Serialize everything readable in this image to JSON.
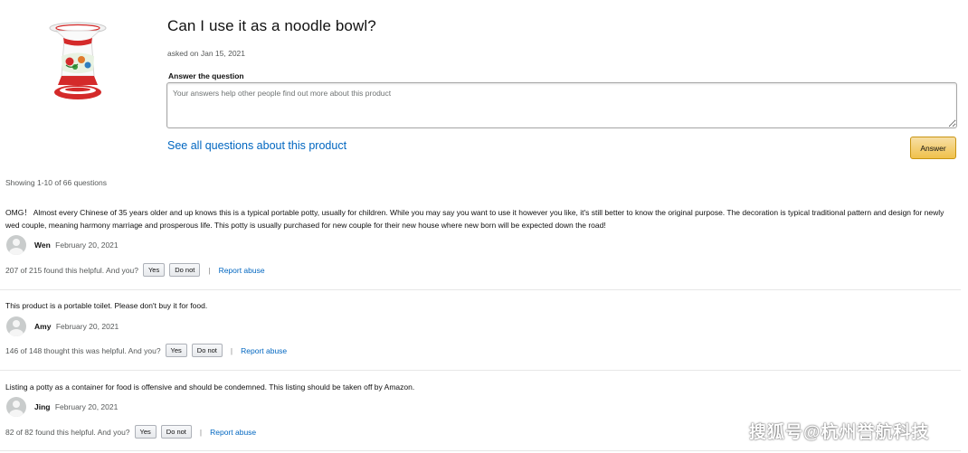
{
  "question": {
    "title": "Can I use it as a noodle bowl?",
    "asked_on": "asked on Jan 15, 2021",
    "answer_label": "Answer the question",
    "answer_placeholder": "Your answers help other people find out more about this product",
    "see_all": "See all questions about this product",
    "answer_button": "Answer"
  },
  "showing": "Showing 1-10 of 66 questions",
  "answers": [
    {
      "text": "OMG！ Almost every Chinese of 35 years older and up knows this is a typical portable potty, usually for children. While you may say you want to use it however you like, it's still better to know the original purpose. The decoration is typical traditional pattern and design for newly wed couple, meaning harmony marriage and prosperous life. This potty is usually purchased for new couple for their new house where new born will be expected down the road!",
      "author": "Wen",
      "date": "February 20, 2021",
      "helpful": "207 of 215 found this helpful. And you?",
      "yes": "Yes",
      "no": "Do not",
      "separator": "|",
      "report": "Report abuse"
    },
    {
      "text": "This product is a portable toilet. Please don't buy it for food.",
      "author": "Amy",
      "date": "February 20, 2021",
      "helpful": "146 of 148 thought this was helpful. And you?",
      "yes": "Yes",
      "no": "Do not",
      "separator": "|",
      "report": "Report abuse"
    },
    {
      "text": "Listing a potty as a container for food is offensive and should be condemned. This listing should be taken off by Amazon.",
      "author": "Jing",
      "date": "February 20, 2021",
      "helpful": "82 of 82 found this helpful. And you?",
      "yes": "Yes",
      "no": "Do not",
      "separator": "|",
      "report": "Report abuse"
    }
  ],
  "watermark": "搜狐号@杭州誉航科技",
  "colors": {
    "link": "#0066c0",
    "answer_button": "#f0c14b",
    "product_red": "#d42a2a"
  },
  "icons": {
    "product": "enamel-spittoon-image",
    "avatar": "default-user-avatar-icon"
  }
}
